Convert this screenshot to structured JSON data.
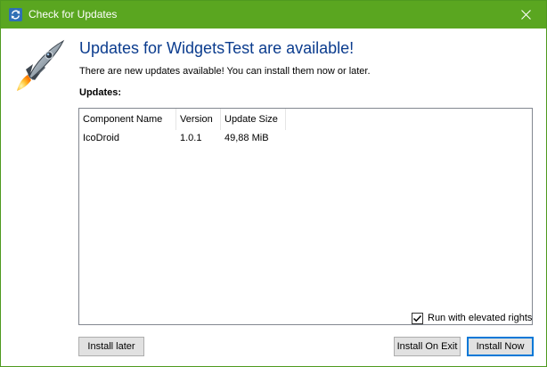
{
  "window": {
    "title": "Check for Updates",
    "titlebar_color": "#5aa620",
    "close_icon": "close-icon",
    "app_icon": "refresh-icon"
  },
  "main": {
    "heading": "Updates for WidgetsTest are available!",
    "heading_color": "#0b3c8e",
    "message": "There are new updates available! You can install them now or later.",
    "updates_label": "Updates:",
    "illustration": "rocket-icon"
  },
  "updates_table": {
    "columns": [
      "Component Name",
      "Version",
      "Update Size"
    ],
    "rows": [
      [
        "IcoDroid",
        "1.0.1",
        "49,88 MiB"
      ]
    ]
  },
  "options": {
    "elevated_label": "Run with elevated rights",
    "elevated_checked": true
  },
  "buttons": {
    "install_later": "Install later",
    "install_on_exit": "Install On Exit",
    "install_now": "Install Now",
    "accent_color": "#0078d7"
  }
}
